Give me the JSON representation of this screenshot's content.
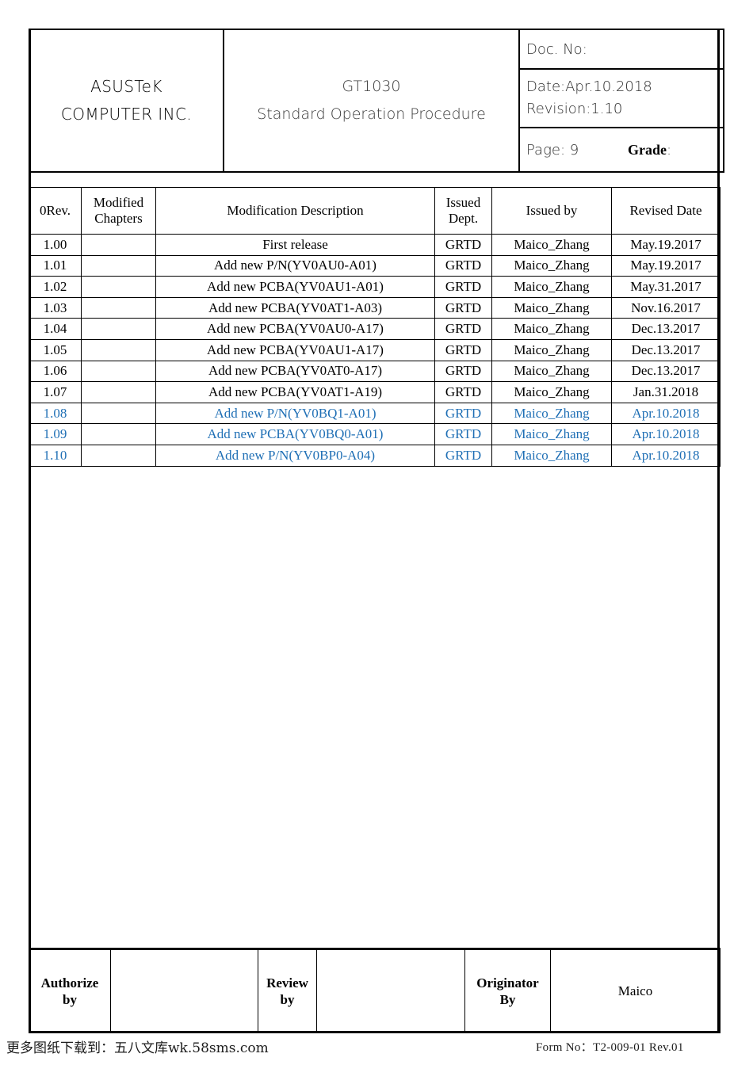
{
  "header": {
    "company": [
      "ASUSTeK",
      "COMPUTER INC."
    ],
    "product": "GT1030",
    "doc_title": "Standard Operation Procedure",
    "doc_no_label": "Doc. No:",
    "doc_no_value": "",
    "date_label": "Date:Apr.10.2018",
    "revision_label": "Revision:1.10",
    "page_label": "Page: 9",
    "grade_label": "Grade",
    "grade_colon": ":"
  },
  "revision_table": {
    "columns": [
      "0Rev.",
      "Modified Chapters",
      "Modification Description",
      "Issued Dept.",
      "Issued by",
      "Revised Date"
    ],
    "columns_multiline": [
      [
        "0Rev."
      ],
      [
        "Modified",
        "Chapters"
      ],
      [
        "Modification Description"
      ],
      [
        "Issued",
        "Dept."
      ],
      [
        "Issued by"
      ],
      [
        "Revised Date"
      ]
    ],
    "highlight_color": "#1F6FB5",
    "rows": [
      {
        "rev": "1.00",
        "chapters": "",
        "description": "First release",
        "dept": "GRTD",
        "issued_by": "Maico_Zhang",
        "date": "May.19.2017",
        "highlight": false
      },
      {
        "rev": "1.01",
        "chapters": "",
        "description": "Add new P/N(YV0AU0-A01)",
        "dept": "GRTD",
        "issued_by": "Maico_Zhang",
        "date": "May.19.2017",
        "highlight": false
      },
      {
        "rev": "1.02",
        "chapters": "",
        "description": "Add new PCBA(YV0AU1-A01)",
        "dept": "GRTD",
        "issued_by": "Maico_Zhang",
        "date": "May.31.2017",
        "highlight": false
      },
      {
        "rev": "1.03",
        "chapters": "",
        "description": "Add new PCBA(YV0AT1-A03)",
        "dept": "GRTD",
        "issued_by": "Maico_Zhang",
        "date": "Nov.16.2017",
        "highlight": false
      },
      {
        "rev": "1.04",
        "chapters": "",
        "description": "Add new PCBA(YV0AU0-A17)",
        "dept": "GRTD",
        "issued_by": "Maico_Zhang",
        "date": "Dec.13.2017",
        "highlight": false
      },
      {
        "rev": "1.05",
        "chapters": "",
        "description": "Add new PCBA(YV0AU1-A17)",
        "dept": "GRTD",
        "issued_by": "Maico_Zhang",
        "date": "Dec.13.2017",
        "highlight": false
      },
      {
        "rev": "1.06",
        "chapters": "",
        "description": "Add new PCBA(YV0AT0-A17)",
        "dept": "GRTD",
        "issued_by": "Maico_Zhang",
        "date": "Dec.13.2017",
        "highlight": false
      },
      {
        "rev": "1.07",
        "chapters": "",
        "description": "Add new PCBA(YV0AT1-A19)",
        "dept": "GRTD",
        "issued_by": "Maico_Zhang",
        "date": "Jan.31.2018",
        "highlight": false
      },
      {
        "rev": "1.08",
        "chapters": "",
        "description": "Add new P/N(YV0BQ1-A01)",
        "dept": "GRTD",
        "issued_by": "Maico_Zhang",
        "date": "Apr.10.2018",
        "highlight": true
      },
      {
        "rev": "1.09",
        "chapters": "",
        "description": "Add new PCBA(YV0BQ0-A01)",
        "dept": "GRTD",
        "issued_by": "Maico_Zhang",
        "date": "Apr.10.2018",
        "highlight": true
      },
      {
        "rev": "1.10",
        "chapters": "",
        "description": "Add new P/N(YV0BP0-A04)",
        "dept": "GRTD",
        "issued_by": "Maico_Zhang",
        "date": "Apr.10.2018",
        "highlight": true
      }
    ]
  },
  "signature": {
    "authorize_label": [
      "Authorize",
      "by"
    ],
    "authorize_value": "",
    "review_label": [
      "Review",
      "by"
    ],
    "review_value": "",
    "originator_label": [
      "Originator",
      "By"
    ],
    "originator_value": "Maico"
  },
  "caption": {
    "left": "更多图纸下载到：五八文库wk.58sms.com",
    "right": "Form No：T2-009-01  Rev.01"
  }
}
